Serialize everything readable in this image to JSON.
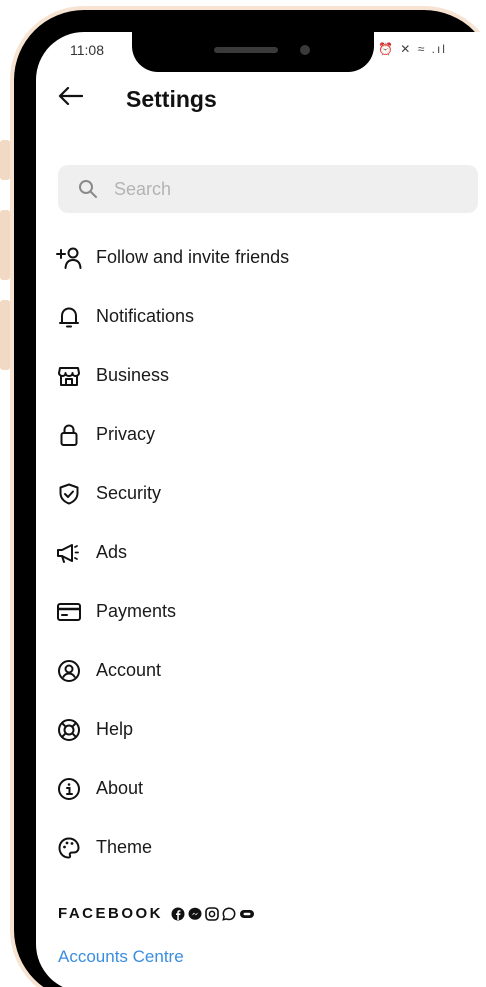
{
  "status_bar": {
    "time": "11:08"
  },
  "header": {
    "title": "Settings"
  },
  "search": {
    "placeholder": "Search"
  },
  "menu": {
    "items": [
      {
        "label": "Follow and invite friends",
        "icon": "add-person-icon"
      },
      {
        "label": "Notifications",
        "icon": "bell-icon"
      },
      {
        "label": "Business",
        "icon": "shop-icon"
      },
      {
        "label": "Privacy",
        "icon": "lock-icon"
      },
      {
        "label": "Security",
        "icon": "shield-check-icon"
      },
      {
        "label": "Ads",
        "icon": "megaphone-icon"
      },
      {
        "label": "Payments",
        "icon": "card-icon"
      },
      {
        "label": "Account",
        "icon": "account-circle-icon"
      },
      {
        "label": "Help",
        "icon": "lifebuoy-icon"
      },
      {
        "label": "About",
        "icon": "info-icon"
      },
      {
        "label": "Theme",
        "icon": "palette-icon"
      }
    ]
  },
  "facebook_section": {
    "label": "FACEBOOK",
    "link": "Accounts Centre",
    "link_color": "#3a8de0"
  }
}
